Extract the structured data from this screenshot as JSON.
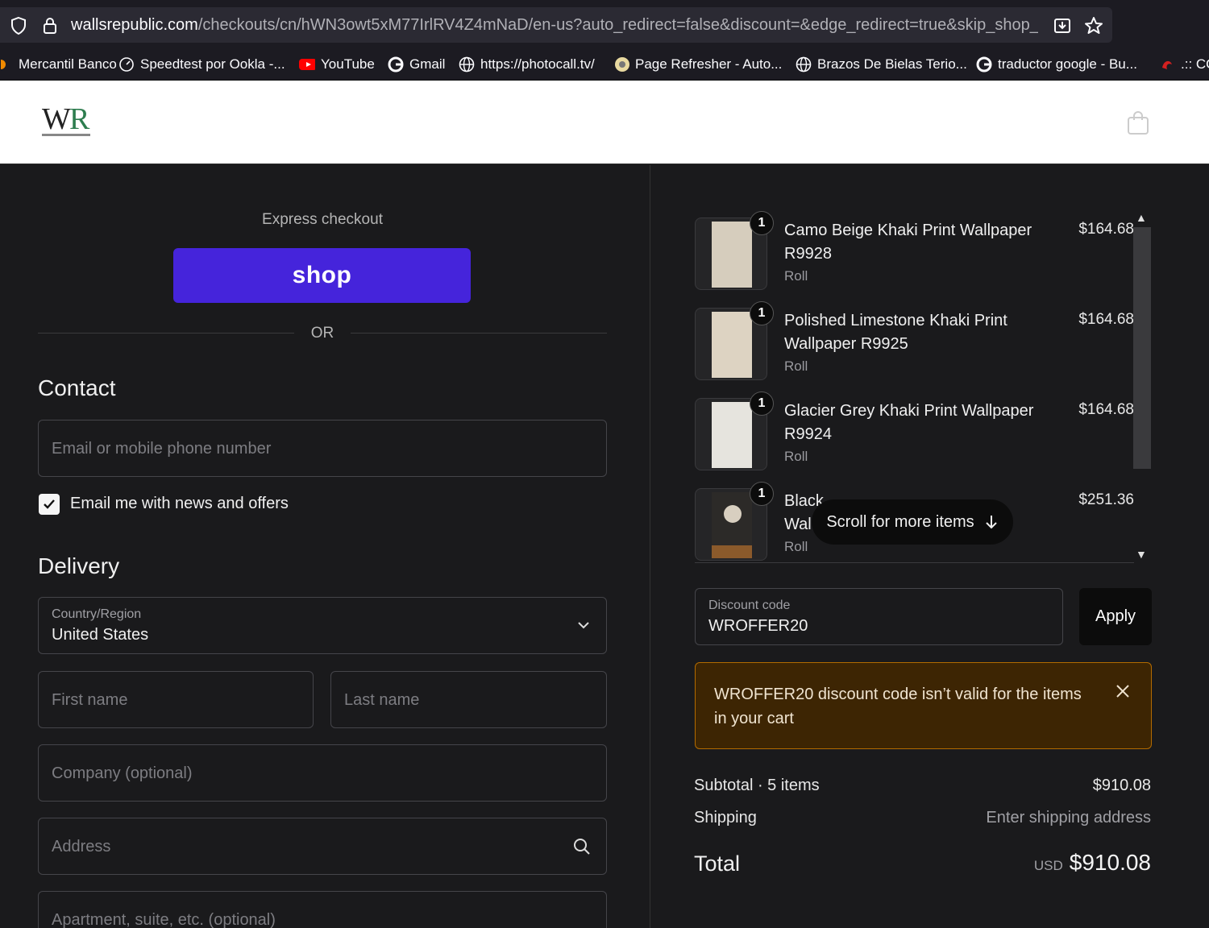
{
  "browser": {
    "url_domain": "wallsrepublic.com",
    "url_path": "/checkouts/cn/hWN3owt5xM77IrlRV4Z4mNaD/en-us?auto_redirect=false&discount=&edge_redirect=true&skip_shop_pay=",
    "bookmarks": [
      {
        "label": "Mercantil Banco",
        "icon": "bank-icon"
      },
      {
        "label": "Speedtest por Ookla -...",
        "icon": "speedtest-icon"
      },
      {
        "label": "YouTube",
        "icon": "youtube-icon"
      },
      {
        "label": "Gmail",
        "icon": "google-icon"
      },
      {
        "label": "https://photocall.tv/",
        "icon": "globe-icon"
      },
      {
        "label": "Page Refresher - Auto...",
        "icon": "refresher-icon"
      },
      {
        "label": "Brazos De Bielas Terio...",
        "icon": "globe-icon"
      },
      {
        "label": "traductor google - Bu...",
        "icon": "google-icon"
      },
      {
        "label": ".:: CO",
        "icon": "site-icon"
      }
    ]
  },
  "checkout": {
    "express_label": "Express checkout",
    "shop_button": "shop",
    "or_text": "OR",
    "contact_title": "Contact",
    "email_placeholder": "Email or mobile phone number",
    "newsletter_label": "Email me with news and offers",
    "delivery_title": "Delivery",
    "country_label": "Country/Region",
    "country_value": "United States",
    "first_name_placeholder": "First name",
    "last_name_placeholder": "Last name",
    "company_placeholder": "Company (optional)",
    "address_placeholder": "Address",
    "apartment_placeholder": "Apartment, suite, etc. (optional)"
  },
  "cart": {
    "items": [
      {
        "name": "Camo Beige Khaki Print Wallpaper R9928",
        "variant": "Roll",
        "price": "$164.68",
        "qty": "1"
      },
      {
        "name": "Polished Limestone Khaki Print Wallpaper R9925",
        "variant": "Roll",
        "price": "$164.68",
        "qty": "1"
      },
      {
        "name": "Glacier Grey Khaki Print Wallpaper R9924",
        "variant": "Roll",
        "price": "$164.68",
        "qty": "1"
      },
      {
        "name_line1": "Black",
        "name_line2": "Wal",
        "variant": "Roll",
        "price": "$251.36",
        "qty": "1"
      }
    ],
    "scroll_hint": "Scroll for more items",
    "discount_label": "Discount code",
    "discount_value": "WROFFER20",
    "apply_label": "Apply",
    "alert_text": "WROFFER20 discount code isn’t valid for the items in your cart",
    "subtotal_label": "Subtotal · 5 items",
    "subtotal_value": "$910.08",
    "shipping_label": "Shipping",
    "shipping_value": "Enter shipping address",
    "total_label": "Total",
    "total_currency": "USD",
    "total_value": "$910.08"
  },
  "colors": {
    "shop_pay_purple": "#4524db",
    "alert_bg": "#3d2503",
    "alert_border": "#b36b00"
  }
}
